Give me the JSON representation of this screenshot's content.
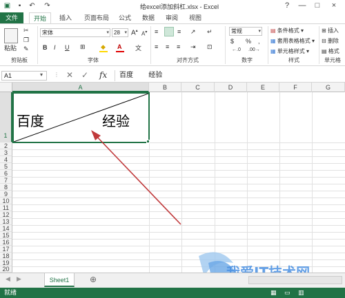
{
  "app": {
    "title": "给excel添加斜杠.xlsx - Excel",
    "colors": {
      "accent": "#217346",
      "arrow": "#c0393b"
    },
    "quick_access": [
      "save-icon",
      "undo-icon",
      "redo-icon"
    ],
    "window_controls": [
      "?",
      "—",
      "□",
      "×"
    ]
  },
  "tabs": [
    "文件",
    "开始",
    "插入",
    "页面布局",
    "公式",
    "数据",
    "审阅",
    "视图"
  ],
  "ribbon": {
    "groups": [
      "剪贴板",
      "字体",
      "对齐方式",
      "数字",
      "样式",
      "单元格"
    ],
    "clipboard": {
      "paste_label": "粘贴"
    },
    "font": {
      "name": "宋体",
      "size": "28",
      "bold": "B",
      "italic": "I",
      "underline": "U",
      "font_color": "A"
    },
    "number": {
      "format": "常规",
      "percent": "%",
      "comma": ","
    },
    "styles": {
      "conditional": "条件格式",
      "table": "套用表格格式",
      "cell": "单元格样式"
    },
    "cells": {
      "insert": "插入",
      "delete": "删除",
      "format": "格式"
    }
  },
  "formula_bar": {
    "name_box": "A1",
    "fx": "fx",
    "content": "百度        经验"
  },
  "grid": {
    "columns": [
      "A",
      "B",
      "C",
      "D",
      "E",
      "F",
      "G"
    ],
    "rows": [
      "1",
      "2",
      "3",
      "4",
      "5",
      "6",
      "7",
      "8",
      "9",
      "10",
      "11",
      "12",
      "13",
      "14",
      "15",
      "16",
      "17",
      "18",
      "19",
      "20"
    ],
    "cell_A1": {
      "left_text": "百度",
      "right_text": "经验"
    }
  },
  "sheets": {
    "active": "Sheet1",
    "add": "⊕"
  },
  "status": {
    "text": "就绪"
  },
  "watermark": "我爱IT技术网"
}
